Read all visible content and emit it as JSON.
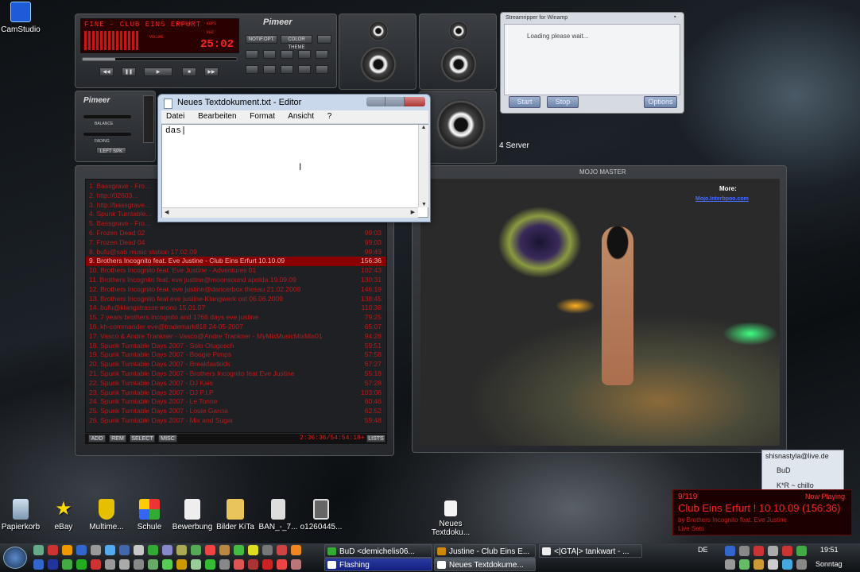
{
  "desktop_icons": [
    {
      "label": "CamStudio"
    },
    {
      "label": "Papierkorb"
    },
    {
      "label": "eBay"
    },
    {
      "label": "Multime..."
    },
    {
      "label": "Schule"
    },
    {
      "label": "Bewerbung"
    },
    {
      "label": "Bilder KiTa"
    },
    {
      "label": "BAN_-_7..."
    },
    {
      "label": "o1260445..."
    },
    {
      "label": "Neues Textdoku..."
    }
  ],
  "winamp": {
    "lcd_title": "FINE - CLUB EINS ERFURT",
    "lcd_kbps": "KBPS",
    "lcd_khz": "KHZ",
    "lcd_stereo": "STEREO",
    "lcd_volume": "VOLUME",
    "lcd_time": "25:02",
    "brand": "Pimeer",
    "buttons": [
      "NOTIF.OPT.",
      "COLOR THEME"
    ],
    "balance": "BALANCE",
    "fading": "FADING",
    "left_spk": "LEFT SPK",
    "server": "4 Server",
    "mojo": "MOJO MASTER",
    "more": "More:",
    "mojo_link": "Mojo.Interbpoo.com"
  },
  "playlist": {
    "rows": [
      {
        "text": "1. Bassgrave - Fro...",
        "time": ""
      },
      {
        "text": "2. http://02603...",
        "time": ""
      },
      {
        "text": "3. http://bassgrave...",
        "time": ""
      },
      {
        "text": "4. Spunk Turntable...",
        "time": ""
      },
      {
        "text": "5. Bassgrave - Fro...",
        "time": ""
      },
      {
        "text": "6. Frozen Dead 02",
        "time": "99:03"
      },
      {
        "text": "7. Frozen Dead 04",
        "time": "99:03"
      },
      {
        "text": "8. bufu@sab music station 17.02.09",
        "time": "99:43"
      },
      {
        "text": "9. Brothers Incognito feat. Eve Justine - Club Eins Erfurt 10.10.09",
        "time": "156:36",
        "selected": true
      },
      {
        "text": "10. Brothers Incognito feat. Eve Justine - Adventures 01",
        "time": "102:43"
      },
      {
        "text": "11. Brothers Incognito feat. eve justine@moonsound apolda 19.09.09",
        "time": "130:31"
      },
      {
        "text": "12. Brothers Incognito feat. eve justine@dancerbox thesau 21.02.2009",
        "time": "146:19"
      },
      {
        "text": "13. Brothers Incognito feat eve justine-Klangwerk ost 06.06.2009",
        "time": "138:45"
      },
      {
        "text": "14. bufu@klangstrasse mono 15.01.07",
        "time": "110:38"
      },
      {
        "text": "15. 7 years brothers incognito and 1766 days eve justine",
        "time": "79:25"
      },
      {
        "text": "16. kh-commander eve@trademark818 24-05-2007",
        "time": "65:07"
      },
      {
        "text": "17. Vasco & Andre Trankner - Vasco@Andre Trankner - MyMixMusicMixMix01",
        "time": "94:28"
      },
      {
        "text": "18. Spunk Turntable Days 2007 - Solo Otugosch",
        "time": "59:51"
      },
      {
        "text": "19. Spunk Turntable Days 2007 - Boogie Pimps",
        "time": "57:58"
      },
      {
        "text": "20. Spunk Turntable Days 2007 - Breakfastkids",
        "time": "67:27"
      },
      {
        "text": "21. Spunk Turntable Days 2007 - Brothers Incognito feat Eve Justine",
        "time": "55:18"
      },
      {
        "text": "22. Spunk Turntable Days 2007 - DJ Kais",
        "time": "57:28"
      },
      {
        "text": "23. Spunk Turntable Days 2007 - DJ P.I.P",
        "time": "103:06"
      },
      {
        "text": "24. Spunk Turntable Days 2007 - Le Tonne",
        "time": "60:46"
      },
      {
        "text": "25. Spunk Turntable Days 2007 - Louie Garcia",
        "time": "62:52"
      },
      {
        "text": "26. Spunk Turntable Days 2007 - Mix and Sugar",
        "time": "59:48"
      }
    ],
    "footer": [
      "ADD",
      "REM",
      "SELECT",
      "MISC"
    ],
    "status": "2:36:36/54:54:18+",
    "lists": "LISTS"
  },
  "streamripper": {
    "title": "Streamripper for Winamp",
    "status": "Loading please wait...",
    "start": "Start",
    "stop": "Stop",
    "options": "Options"
  },
  "notepad": {
    "title": "Neues Textdokument.txt - Editor",
    "menu": [
      "Datei",
      "Bearbeiten",
      "Format",
      "Ansicht",
      "?"
    ],
    "content": "das|"
  },
  "msn": {
    "items": [
      "shisnastyla@live.de",
      "BuD",
      "K*R ~ chillo"
    ]
  },
  "now_playing": {
    "label": "Now Playing",
    "count": "9/119",
    "title": "Club Eins Erfurt ! 10.10.09 (156:36)",
    "artist": "by Brothers Incognito feat. Eve Justine",
    "extra": "Live Sets"
  },
  "taskbar": {
    "buttons": [
      "BuD <demichelis06...",
      "Justine - Club Eins E...",
      "<|GTA|> tankwart - ...",
      "Flashing",
      "Neues Textdokume..."
    ],
    "lang": "DE",
    "time": "19:51",
    "day": "Sonntag"
  }
}
